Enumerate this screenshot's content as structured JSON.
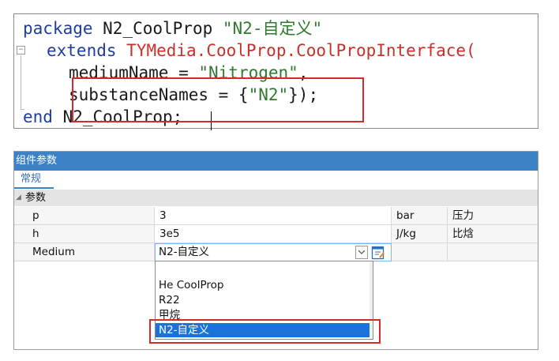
{
  "code": {
    "line1": {
      "kw": "package",
      "name": " N2_CoolProp ",
      "str": "\"N2-自定义\""
    },
    "line2": {
      "kw": "extends",
      "type": "TYMedia.CoolProp.CoolPropInterface("
    },
    "line3": {
      "name": "mediumName = ",
      "str": "\"Nitrogen\"",
      "tail": ","
    },
    "line4": {
      "name": "substanceNames = {",
      "str": "\"N2\"",
      "tail": "});"
    },
    "line5": {
      "kw": "end",
      "name": " N2_CoolProp;"
    }
  },
  "panel": {
    "title": "组件参数",
    "tab": "常规",
    "group": "参数",
    "rows": [
      {
        "name": "p",
        "value": "3",
        "unit": "bar",
        "desc": "压力"
      },
      {
        "name": "h",
        "value": "3e5",
        "unit": "J/kg",
        "desc": "比焓"
      },
      {
        "name": "Medium",
        "value": "N2-自定义",
        "unit": "",
        "desc": ""
      }
    ]
  },
  "dropdown": {
    "options": [
      "He CoolProp",
      "R22",
      "甲烷",
      "N2-自定义"
    ],
    "selected": "N2-自定义"
  },
  "colors": {
    "accent": "#3c82c4",
    "highlight": "#d62a2a",
    "selection": "#1a74d8"
  }
}
